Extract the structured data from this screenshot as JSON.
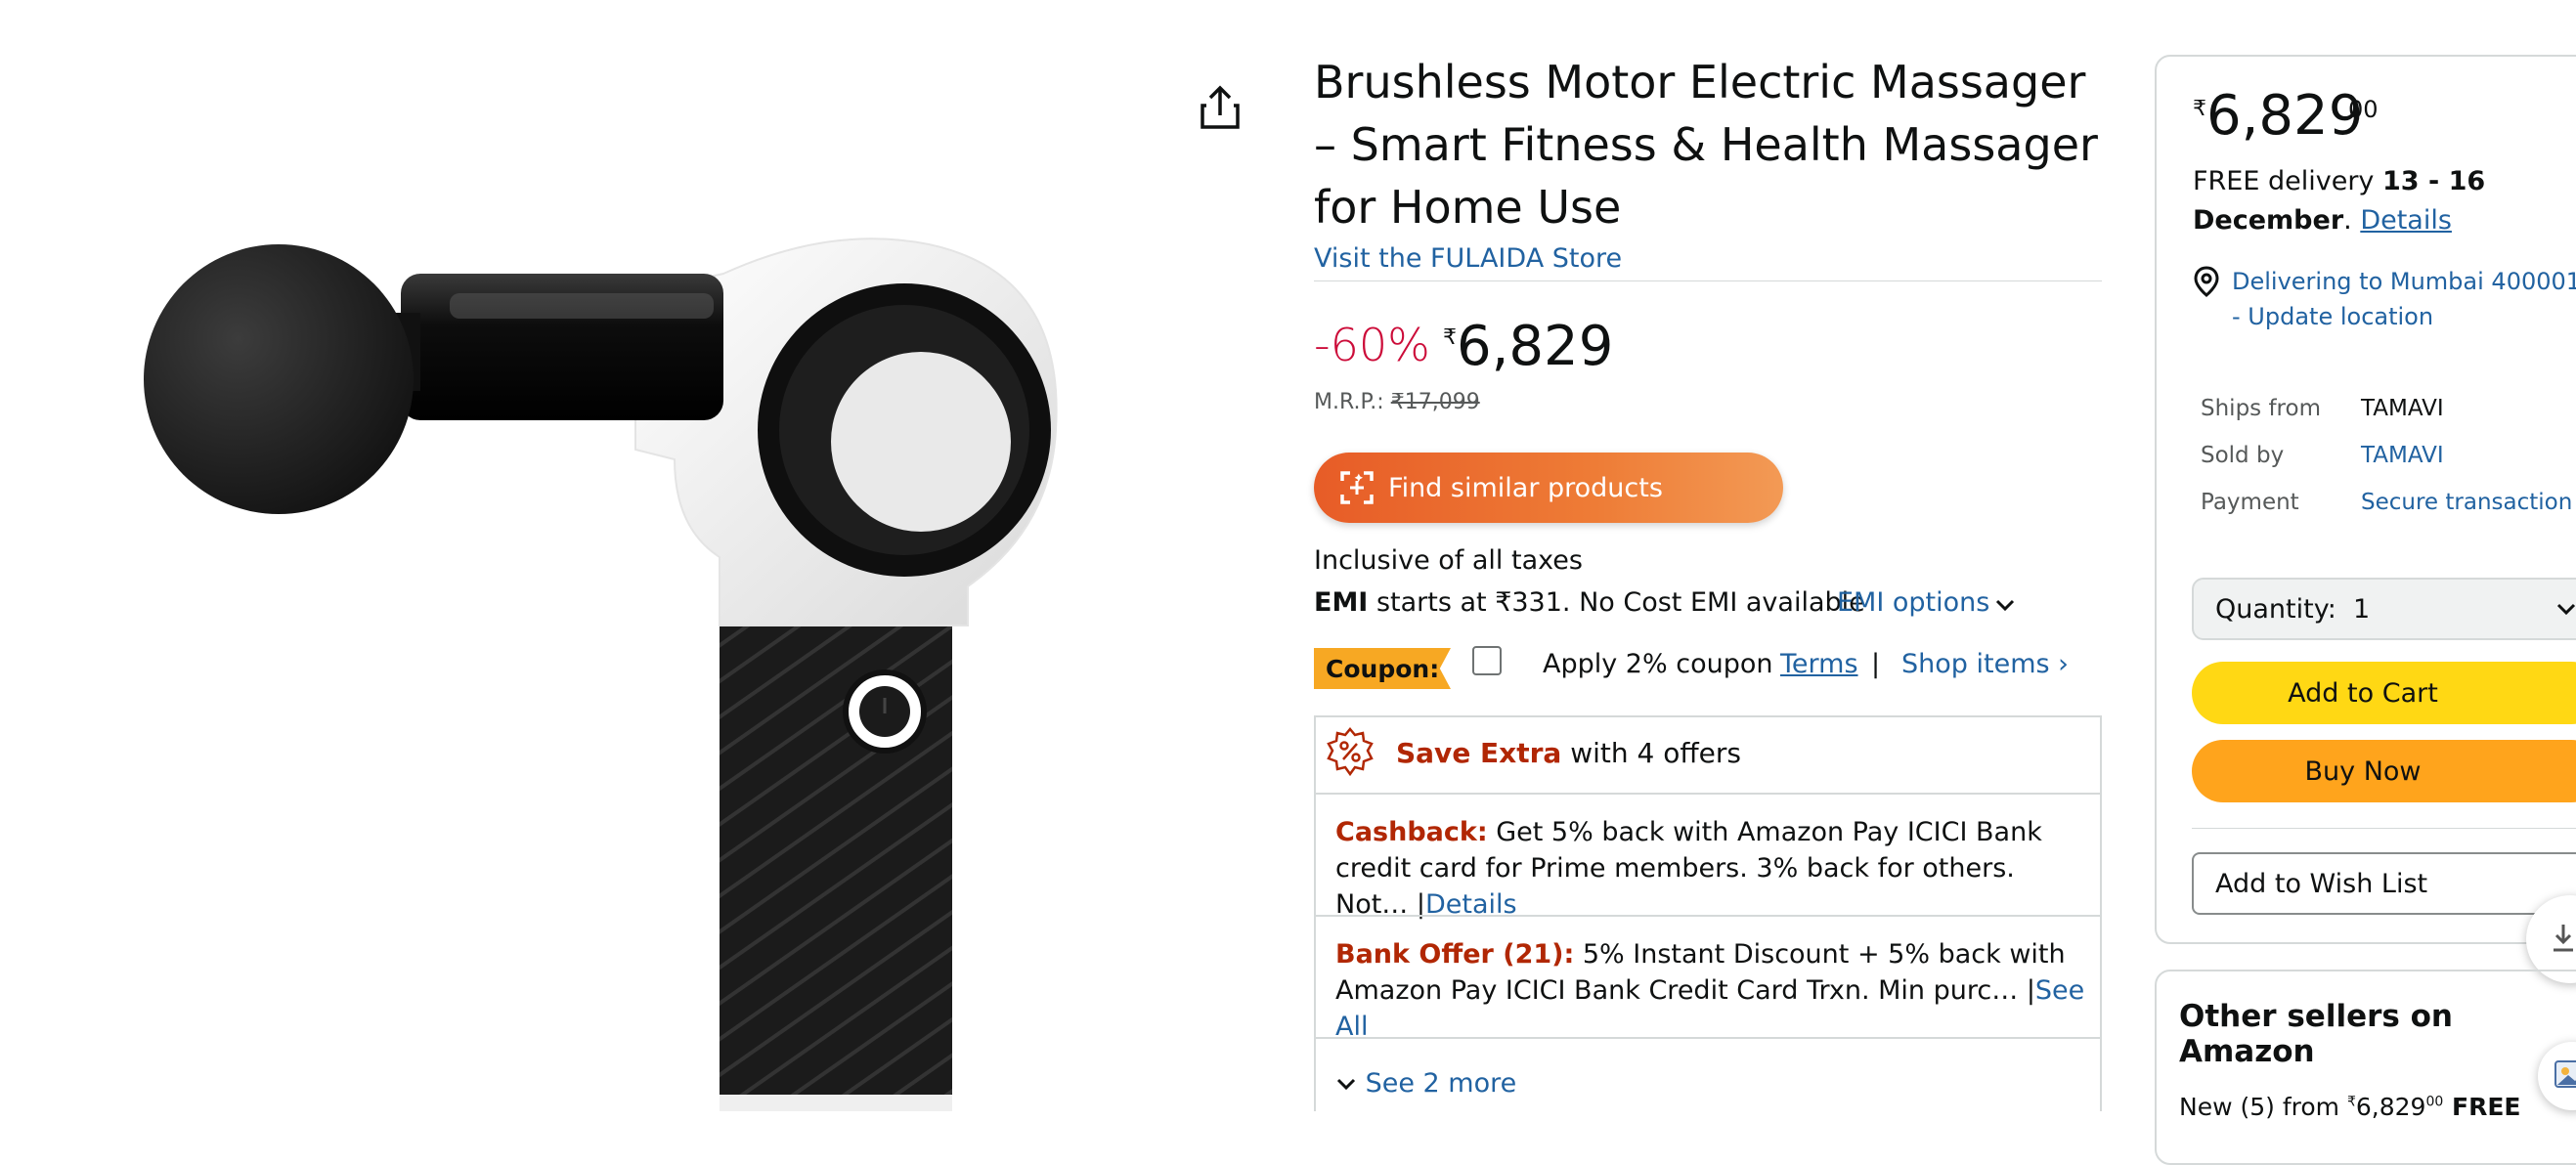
{
  "product": {
    "title": "Brushless Motor Electric Massager – Smart Fitness & Health Massager for Home Use",
    "store_link": "Visit the FULAIDA Store",
    "discount": "-60%",
    "currency_symbol": "₹",
    "price": "6,829",
    "mrp_label": "M.R.P.: ",
    "mrp_value": "₹17,099",
    "find_similar_label": "Find similar products",
    "taxes_text": "Inclusive of all taxes",
    "emi": {
      "label": "EMI",
      "text": " starts at ₹331. No Cost EMI available",
      "options_label": "EMI options"
    },
    "coupon": {
      "badge": "Coupon:",
      "text": "Apply 2% coupon",
      "terms_label": "Terms",
      "separator": "|",
      "shop_items_label": "Shop items ›"
    },
    "offers": {
      "header_bold": "Save Extra",
      "header_text": " with 4 offers",
      "items": [
        {
          "label": "Cashback:",
          "text": " Get 5% back with Amazon Pay ICICI Bank credit card for Prime members. 3% back for others. Not… ",
          "link": "Details"
        },
        {
          "label": "Bank Offer (21):",
          "text": " 5% Instant Discount + 5% back with Amazon Pay ICICI Bank Credit Card Trxn. Min purc… ",
          "link": "See All"
        }
      ],
      "see_more_label": "See 2 more"
    }
  },
  "buybox": {
    "currency_symbol": "₹",
    "price_whole": "6,829",
    "price_fraction": "00",
    "delivery_text": "FREE delivery ",
    "delivery_dates": "13 - 16 December",
    "delivery_period": ". ",
    "delivery_details_link": "Details",
    "location_text": "Delivering to Mumbai 400001 - Update location",
    "ships_from_label": "Ships from",
    "ships_from_value": "TAMAVI",
    "sold_by_label": "Sold by",
    "sold_by_value": "TAMAVI",
    "payment_label": "Payment",
    "payment_value": "Secure transaction",
    "quantity_label": "Quantity:",
    "quantity_value": "1",
    "add_to_cart_label": "Add to Cart",
    "buy_now_label": "Buy Now",
    "wish_list_label": "Add to Wish List"
  },
  "other_sellers": {
    "title": "Other sellers on Amazon",
    "line_prefix": "New (5) from ",
    "currency_symbol": "₹",
    "price_whole": "6,829",
    "price_fraction": "00",
    "line_suffix": " FREE"
  },
  "icons": {
    "share": "share-icon",
    "find_similar": "camera-search-icon",
    "emi_chevron": "chevron-down-icon",
    "save_extra": "percent-badge-icon",
    "see_more_chevron": "chevron-down-icon",
    "location": "location-pin-icon",
    "quantity_chevron": "chevron-down-icon"
  },
  "colors": {
    "discount": "#cc0c39",
    "link": "#2162a1",
    "offer_label": "#b12704",
    "add_to_cart": "#ffd814",
    "buy_now": "#ffa41c",
    "coupon_badge": "#f7a823",
    "find_similar_start": "#e75c27",
    "find_similar_end": "#f39a55"
  }
}
